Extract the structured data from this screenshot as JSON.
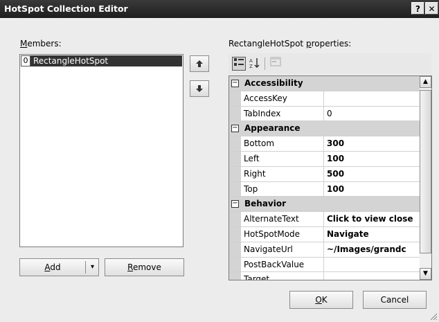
{
  "window": {
    "title": "HotSpot Collection Editor",
    "help_label": "?",
    "close_label": "✕"
  },
  "members": {
    "label_access_key": "M",
    "label_rest": "embers:",
    "items": [
      {
        "index": "0",
        "label": "RectangleHotSpot"
      }
    ],
    "move_up_glyph": "🡅",
    "move_down_glyph": "🡇"
  },
  "buttons": {
    "add_key": "A",
    "add_rest": "dd",
    "add_dropdown_glyph": "▾",
    "remove_key": "R",
    "remove_rest": "emove",
    "ok_key": "O",
    "ok_rest": "K",
    "cancel": "Cancel"
  },
  "properties": {
    "header_prefix": "RectangleHotSpot ",
    "header_key": "p",
    "header_rest": "roperties:",
    "toolbar": {
      "categorized_icon": "categorized-icon",
      "alphabetical_icon": "alphabetical-icon",
      "property_pages_icon": "property-pages-icon"
    },
    "rows": [
      {
        "type": "category",
        "toggle": "⊟",
        "name": "Accessibility"
      },
      {
        "type": "prop",
        "name": "AccessKey",
        "value": "",
        "bold": false
      },
      {
        "type": "prop",
        "name": "TabIndex",
        "value": "0",
        "bold": false
      },
      {
        "type": "category",
        "toggle": "⊟",
        "name": "Appearance"
      },
      {
        "type": "prop",
        "name": "Bottom",
        "value": "300",
        "bold": true
      },
      {
        "type": "prop",
        "name": "Left",
        "value": "100",
        "bold": true
      },
      {
        "type": "prop",
        "name": "Right",
        "value": "500",
        "bold": true
      },
      {
        "type": "prop",
        "name": "Top",
        "value": "100",
        "bold": true
      },
      {
        "type": "category",
        "toggle": "⊟",
        "name": "Behavior"
      },
      {
        "type": "prop",
        "name": "AlternateText",
        "value": "Click to view close",
        "bold": true
      },
      {
        "type": "prop",
        "name": "HotSpotMode",
        "value": "Navigate",
        "bold": true
      },
      {
        "type": "prop",
        "name": "NavigateUrl",
        "value": "~/Images/grandc",
        "bold": true
      },
      {
        "type": "prop",
        "name": "PostBackValue",
        "value": "",
        "bold": false
      },
      {
        "type": "prop",
        "name": "Target",
        "value": "",
        "bold": false
      }
    ]
  }
}
